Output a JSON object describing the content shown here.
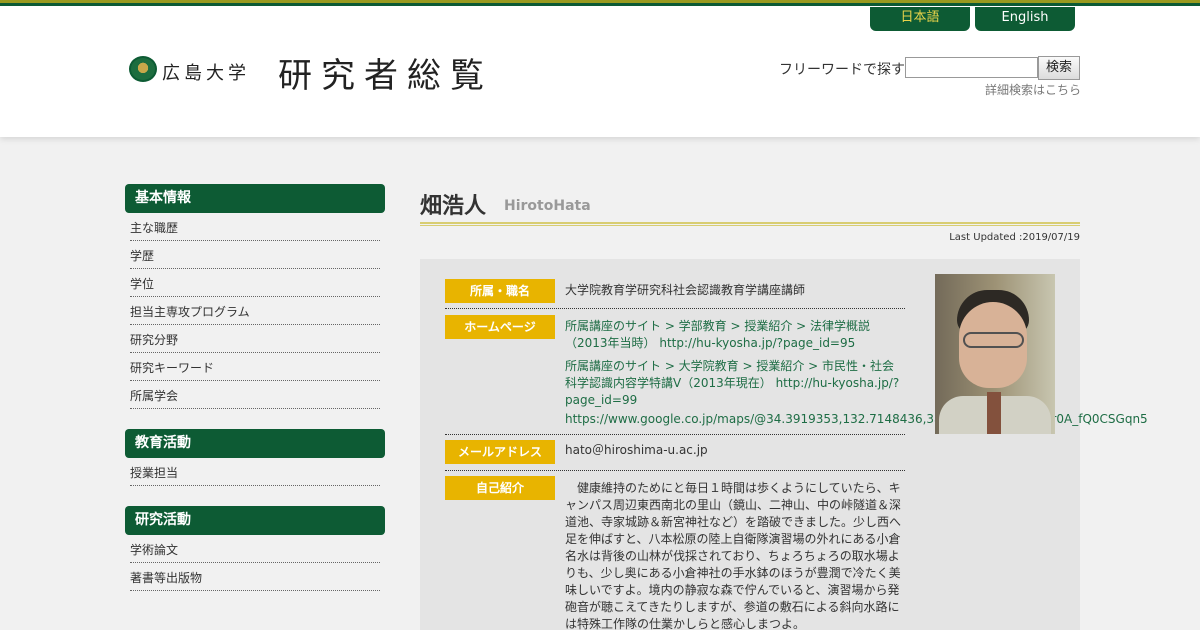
{
  "header": {
    "language_ja": "日本語",
    "language_en": "English",
    "university_name": "広島大学",
    "site_title": "研究者総覧",
    "search_label": "フリーワードで探す",
    "search_input_value": "",
    "search_button": "検索",
    "advanced_search_link": "詳細検索はこちら"
  },
  "sidebar": {
    "sections": [
      {
        "title": "基本情報",
        "items": [
          "主な職歴",
          "学歴",
          "学位",
          "担当主専攻プログラム",
          "研究分野",
          "研究キーワード",
          "所属学会"
        ]
      },
      {
        "title": "教育活動",
        "items": [
          "授業担当"
        ]
      },
      {
        "title": "研究活動",
        "items": [
          "学術論文",
          "著書等出版物"
        ]
      }
    ]
  },
  "profile": {
    "name_ja": "畑浩人",
    "name_romaji": "HirotoHata",
    "last_updated": "Last Updated :2019/07/19",
    "fields": {
      "affiliation_label": "所属・職名",
      "affiliation_value": "大学院教育学研究科社会認識教育学講座講師",
      "homepage_label": "ホームページ",
      "homepage_links": [
        "所属講座のサイト > 学部教育 > 授業紹介 > 法律学概説（2013年当時） http://hu-kyosha.jp/?page_id=95",
        "所属講座のサイト > 大学院教育 > 授業紹介 > 市民性・社会科学認識内容学特講Ⅴ（2013年現在） http://hu-kyosha.jp/?page_id=99",
        "https://www.google.co.jp/maps/@34.3919353,132.7148436,3a,75y,9...!3m4!1skJr0A_fQ0CSGqn5"
      ],
      "email_label": "メールアドレス",
      "email_value": "hato＠hiroshima-u.ac.jp",
      "intro_label": "自己紹介",
      "intro_value": "　健康維持のためにと毎日１時間は歩くようにしていたら、キャンパス周辺東西南北の里山（鏡山、二神山、中の峠隧道＆深道池、寺家城跡＆新宮神社など）を踏破できました。少し西へ足を伸ばすと、八本松原の陸上自衛隊演習場の外れにある小倉名水は背後の山林が伐採されており、ちょろちょろの取水場よりも、少し奥にある小倉神社の手水鉢のほうが豊潤で冷たく美味しいですよ。境内の静寂な森で佇んでいると、演習場から発砲音が聴こえてきたりしますが、参道の敷石による斜向水路には特殊工作隊の仕業かしらと感心しまつよ。"
    }
  },
  "colors": {
    "brand_green": "#0d5b34",
    "accent_gold": "#e8b400",
    "link_green": "#1e6d45"
  },
  "icons": {
    "logo": "hiroshima-university-logo-icon",
    "photo": "profile-photo-icon"
  }
}
